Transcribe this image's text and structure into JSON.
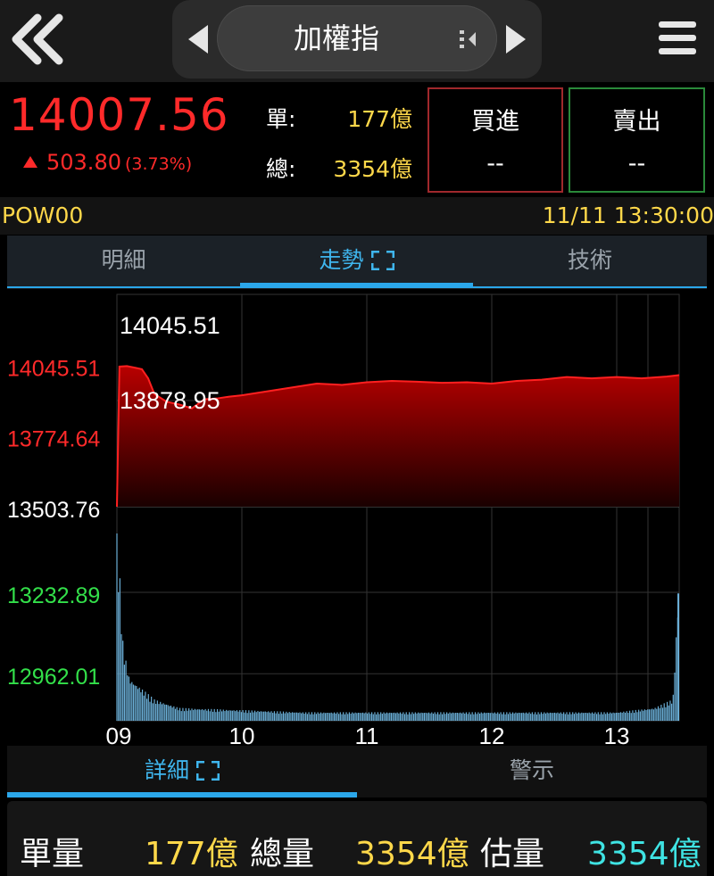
{
  "header": {
    "title": "加權指",
    "colors": {
      "bg": "#1a1a1a",
      "pill": "#3d3d3d"
    },
    "icons": {
      "back": "double-chevron-left-icon",
      "prev": "triangle-left-icon",
      "next": "triangle-right-icon",
      "swap": "swap-icon",
      "menu": "hamburger-menu-icon"
    }
  },
  "quote": {
    "price": "14007.56",
    "change": "503.80",
    "change_pct": "(3.73%)",
    "single_label": "單:",
    "single_value": "177億",
    "total_label": "總:",
    "total_value": "3354億",
    "buy_label": "買進",
    "buy_value": "--",
    "sell_label": "賣出",
    "sell_value": "--",
    "colors": {
      "up": "#ff2a2a",
      "value": "#ffd84a",
      "buy_border": "#a0282c",
      "sell_border": "#2a8a3a"
    }
  },
  "info": {
    "code": "POW00",
    "datetime": "11/11 13:30:00"
  },
  "tabs": [
    {
      "label": "明細"
    },
    {
      "label": "走勢"
    },
    {
      "label": "技術"
    }
  ],
  "chart_data": {
    "type": "area",
    "ylim": [
      13503.76,
      14316.39
    ],
    "high_label": "14045.51",
    "low_label": "13878.95",
    "y_ticks": [
      {
        "label": "14045.51",
        "value": 14045.51,
        "color": "#ff2a2a"
      },
      {
        "label": "13774.64",
        "value": 13774.64,
        "color": "#ff2a2a"
      },
      {
        "label": "13503.76",
        "value": 13503.76,
        "color": "#ffffff"
      },
      {
        "label": "13232.89",
        "value": 13232.89,
        "color": "#33e04a"
      },
      {
        "label": "12962.01",
        "value": 12962.01,
        "color": "#33e04a"
      }
    ],
    "x_ticks": [
      "09",
      "10",
      "11",
      "12",
      "13"
    ],
    "x_range_hours": [
      9,
      13.5
    ],
    "series": [
      {
        "x": [
          9.0,
          9.02,
          9.08,
          9.15,
          9.2,
          9.25,
          9.3,
          9.4,
          9.5,
          9.6,
          9.7,
          9.8,
          9.9,
          10.0,
          10.2,
          10.4,
          10.6,
          10.8,
          11.0,
          11.2,
          11.4,
          11.6,
          11.8,
          12.0,
          12.2,
          12.4,
          12.6,
          12.8,
          13.0,
          13.2,
          13.4,
          13.5
        ],
        "y": [
          13503.76,
          14040,
          14042,
          14035,
          14030,
          13995,
          13935,
          13905,
          13895,
          13880,
          13915,
          13918,
          13925,
          13930,
          13945,
          13960,
          13975,
          13970,
          13980,
          13985,
          13982,
          13978,
          13980,
          13975,
          13985,
          13990,
          14000,
          13995,
          14000,
          13995,
          14002,
          14007.56
        ]
      }
    ],
    "volume": {
      "x": [
        9.0,
        9.05,
        9.1,
        9.2,
        9.3,
        9.5,
        10.0,
        10.5,
        11.0,
        11.5,
        12.0,
        12.5,
        13.0,
        13.3,
        13.45,
        13.5
      ],
      "rel": [
        0.95,
        0.35,
        0.2,
        0.15,
        0.1,
        0.06,
        0.05,
        0.04,
        0.04,
        0.04,
        0.04,
        0.04,
        0.04,
        0.06,
        0.1,
        0.68
      ]
    },
    "colors": {
      "fill_top": "#b80000",
      "line": "#ff2020",
      "volume": "#6aaed6",
      "grid": "#333333"
    }
  },
  "bottom_tabs": [
    {
      "label": "詳細"
    },
    {
      "label": "警示"
    }
  ],
  "summary": {
    "single_label": "單量",
    "single_value": "177億",
    "total_label": "總量",
    "total_value": "3354億",
    "est_label": "估量",
    "est_value": "3354億",
    "colors": {
      "value": "#ffd84a",
      "est": "#3fe3e3"
    }
  }
}
